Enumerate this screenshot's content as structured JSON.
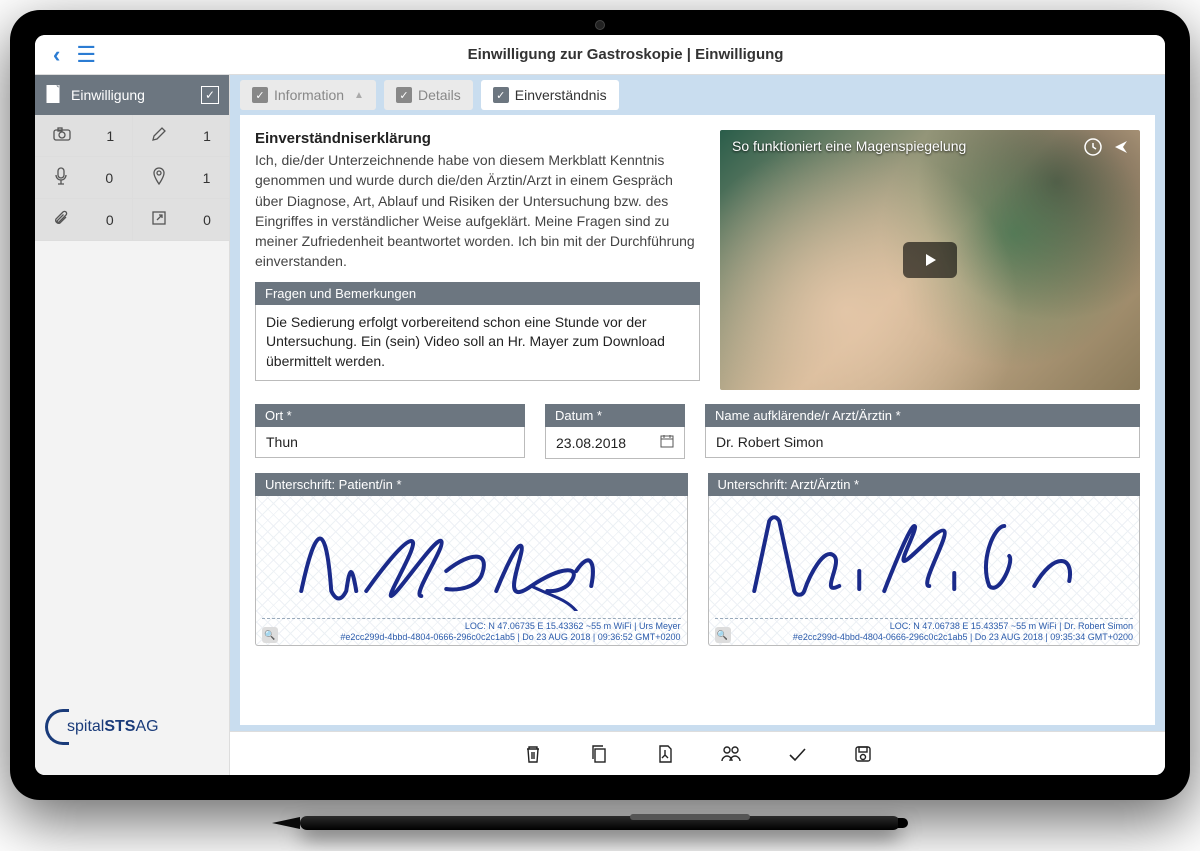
{
  "header": {
    "title": "Einwilligung zur Gastroskopie | Einwilligung"
  },
  "sidebar": {
    "label": "Einwilligung",
    "counters": {
      "camera": "1",
      "edit": "1",
      "mic": "0",
      "pin": "1",
      "attach": "0",
      "link": "0"
    },
    "logo": {
      "sp": "spital",
      "sts": "STS",
      "ag": "AG"
    }
  },
  "tabs": {
    "info": "Information",
    "details": "Details",
    "consent": "Einverständnis"
  },
  "decl": {
    "title": "Einverständniserklärung",
    "text": "Ich, die/der Unterzeichnende habe von diesem Merkblatt Kenntnis genommen und wurde durch die/den Ärztin/Arzt in einem Gespräch über Diagnose, Art, Ablauf und Risiken der Untersuchung bzw. des Eingriffes in verständlicher Weise aufgeklärt. Meine Fragen sind zu meiner Zufriedenheit beantwortet worden. Ich bin mit der Durchführung einverstanden.",
    "remarks_label": "Fragen und Bemerkungen",
    "remarks_text": "Die Sedierung erfolgt vorbereitend schon eine Stunde vor der Untersuchung. Ein (sein) Video soll an Hr. Mayer zum Download übermittelt werden."
  },
  "video": {
    "title": "So funktioniert eine Magenspiegelung"
  },
  "fields": {
    "ort_label": "Ort *",
    "ort_value": "Thun",
    "datum_label": "Datum *",
    "datum_value": "23.08.2018",
    "arzt_label": "Name aufklärende/r Arzt/Ärztin *",
    "arzt_value": "Dr. Robert Simon"
  },
  "sign": {
    "patient_label": "Unterschrift: Patient/in *",
    "patient_meta_line1": "LOC: N 47.06735  E 15.43362  ~55 m  WiFi  |  Urs Meyer",
    "patient_meta_line2": "#e2cc299d-4bbd-4804-0666-296c0c2c1ab5  |  Do 23 AUG 2018  |  09:36:52 GMT+0200",
    "doctor_label": "Unterschrift: Arzt/Ärztin *",
    "doctor_meta_line1": "LOC: N 47.06738  E 15.43357  ~55 m  WiFi  |  Dr. Robert Simon",
    "doctor_meta_line2": "#e2cc299d-4bbd-4804-0666-296c0c2c1ab5  |  Do 23 AUG 2018  |  09:35:34 GMT+0200"
  }
}
